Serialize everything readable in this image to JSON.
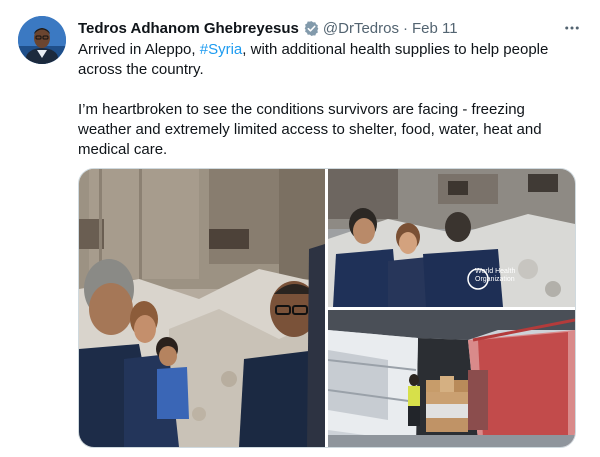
{
  "author": {
    "name": "Tedros Adhanom Ghebreyesus",
    "handle": "@DrTedros",
    "separator": "·",
    "date": "Feb 11",
    "verified_icon": "verified-badge-icon",
    "more_icon": "more-horizontal-icon"
  },
  "tweet": {
    "p1_before": "Arrived in Aleppo, ",
    "p1_hashtag": "#Syria",
    "p1_after": ", with additional health supplies to help people across the country.",
    "p2": "I’m heartbroken to see the conditions survivors are facing - freezing weather and extremely limited access to shelter, food, water, heat and medical care."
  },
  "media": {
    "count": 3,
    "photo_3_org_text": "World Health Organization"
  },
  "colors": {
    "link": "#1d9bf0",
    "text": "#0f1419",
    "secondary": "#536471",
    "border": "#cfd9de"
  }
}
